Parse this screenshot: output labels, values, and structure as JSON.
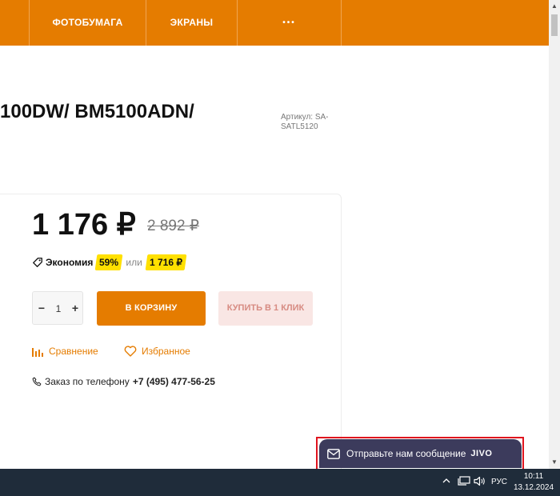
{
  "nav": {
    "items": [
      "ФОТОБУМАГА",
      "ЭКРАНЫ",
      "•••"
    ]
  },
  "product": {
    "title": "100DW/ BM5100ADN/",
    "sku_label": "Артикул: SA-SATL5120"
  },
  "pricing": {
    "price": "1 176 ₽",
    "old_price": "2 892 ₽",
    "savings_label": "Экономия",
    "savings_percent": "59%",
    "or_label": "или",
    "savings_amount": "1 716 ₽"
  },
  "quantity": {
    "minus": "−",
    "value": "1",
    "plus": "+"
  },
  "buttons": {
    "cart": "В КОРЗИНУ",
    "one_click": "КУПИТЬ В 1 КЛИК"
  },
  "links": {
    "compare": "Сравнение",
    "favorites": "Избранное"
  },
  "phone": {
    "label": "Заказ по телефону",
    "number": "+7 (495) 477-56-25"
  },
  "chat": {
    "text": "Отправьте нам сообщение",
    "brand": "JIVO"
  },
  "taskbar": {
    "language": "РУС",
    "time": "10:11",
    "date": "13.12.2024"
  },
  "colors": {
    "accent": "#e57c00",
    "highlight": "#ffe000",
    "chat_bg": "#3c3b5c",
    "taskbar_bg": "#1f2c3a"
  }
}
